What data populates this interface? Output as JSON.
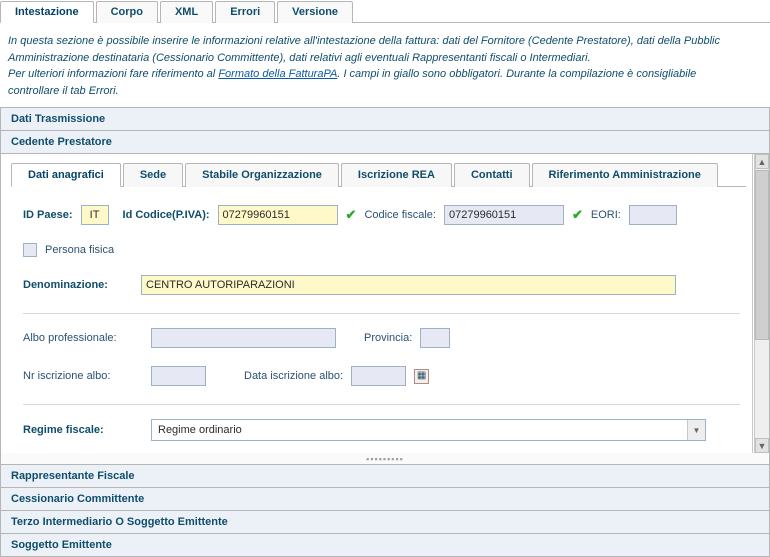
{
  "top_tabs": {
    "intestazione": "Intestazione",
    "corpo": "Corpo",
    "xml": "XML",
    "errori": "Errori",
    "versione": "Versione"
  },
  "intro": {
    "line1a": "In questa sezione è possibile inserire le informazioni relative all'intestazione della fattura: dati del Fornitore (Cedente Prestatore), dati della Pubblic",
    "line2": "Amministrazione destinataria (Cessionario Committente), dati relativi agli eventuali Rappresentanti fiscali o Intermediari.",
    "line3a": "Per ulteriori informazioni fare riferimento al ",
    "link": "Formato della FatturaPA",
    "line3b": ". I campi in giallo sono obbligatori. Durante la compilazione è consigliabile",
    "line4": "controllare il tab Errori."
  },
  "accordion": {
    "dati_trasmissione": "Dati Trasmissione",
    "cedente_prestatore": "Cedente Prestatore",
    "rappresentante_fiscale": "Rappresentante Fiscale",
    "cessionario_committente": "Cessionario Committente",
    "terzo_intermediario": "Terzo Intermediario O Soggetto Emittente",
    "soggetto_emittente": "Soggetto Emittente"
  },
  "inner_tabs": {
    "dati_anagrafici": "Dati anagrafici",
    "sede": "Sede",
    "stabile_org": "Stabile Organizzazione",
    "iscrizione_rea": "Iscrizione REA",
    "contatti": "Contatti",
    "rif_amm": "Riferimento Amministrazione"
  },
  "form": {
    "id_paese_label": "ID Paese:",
    "id_paese_value": "IT",
    "id_codice_label": "Id Codice(P.IVA):",
    "id_codice_value": "07279960151",
    "codice_fiscale_label": "Codice fiscale:",
    "codice_fiscale_value": "07279960151",
    "eori_label": "EORI:",
    "eori_value": "",
    "persona_fisica_label": "Persona fisica",
    "denominazione_label": "Denominazione:",
    "denominazione_value": "CENTRO AUTORIPARAZIONI",
    "albo_prof_label": "Albo professionale:",
    "provincia_label": "Provincia:",
    "nr_iscrizione_label": "Nr iscrizione albo:",
    "data_iscrizione_label": "Data iscrizione albo:",
    "regime_fiscale_label": "Regime fiscale:",
    "regime_fiscale_value": "Regime ordinario"
  }
}
